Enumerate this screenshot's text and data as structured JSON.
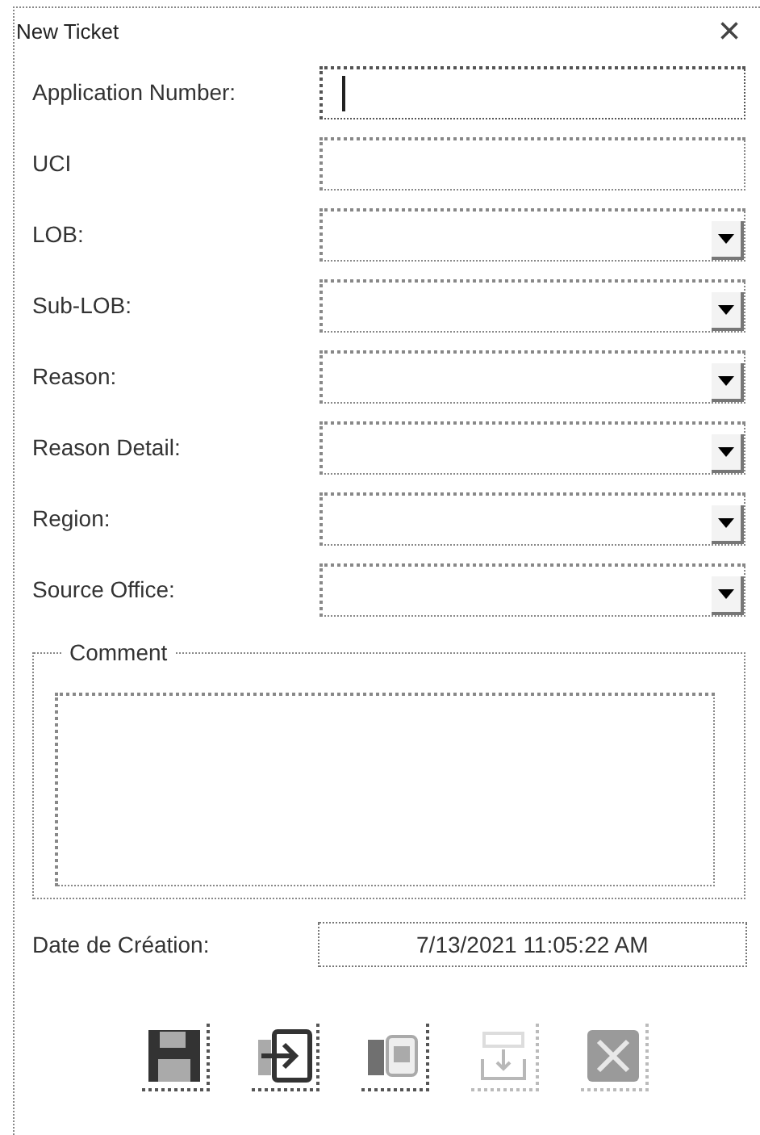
{
  "window": {
    "title": "New Ticket",
    "close": "×"
  },
  "fields": [
    {
      "label": "Application Number:",
      "kind": "text",
      "focused": true
    },
    {
      "label": "UCI",
      "kind": "text",
      "focused": false
    },
    {
      "label": "LOB:",
      "kind": "dropdown",
      "focused": false
    },
    {
      "label": "Sub-LOB:",
      "kind": "dropdown",
      "focused": false
    },
    {
      "label": "Reason:",
      "kind": "dropdown",
      "focused": false
    },
    {
      "label": "Reason Detail:",
      "kind": "dropdown",
      "focused": false
    },
    {
      "label": "Region:",
      "kind": "dropdown",
      "focused": false
    },
    {
      "label": "Source Office:",
      "kind": "dropdown",
      "focused": false
    }
  ],
  "comment": {
    "label": "Comment"
  },
  "date": {
    "label": "Date de Création:",
    "value": "7/13/2021 11:05:22 AM"
  },
  "buttons": [
    {
      "kind": "save",
      "disabled": false
    },
    {
      "kind": "submit",
      "disabled": false
    },
    {
      "kind": "copy",
      "disabled": false
    },
    {
      "kind": "import",
      "disabled": true
    },
    {
      "kind": "cancel",
      "disabled": true
    }
  ]
}
